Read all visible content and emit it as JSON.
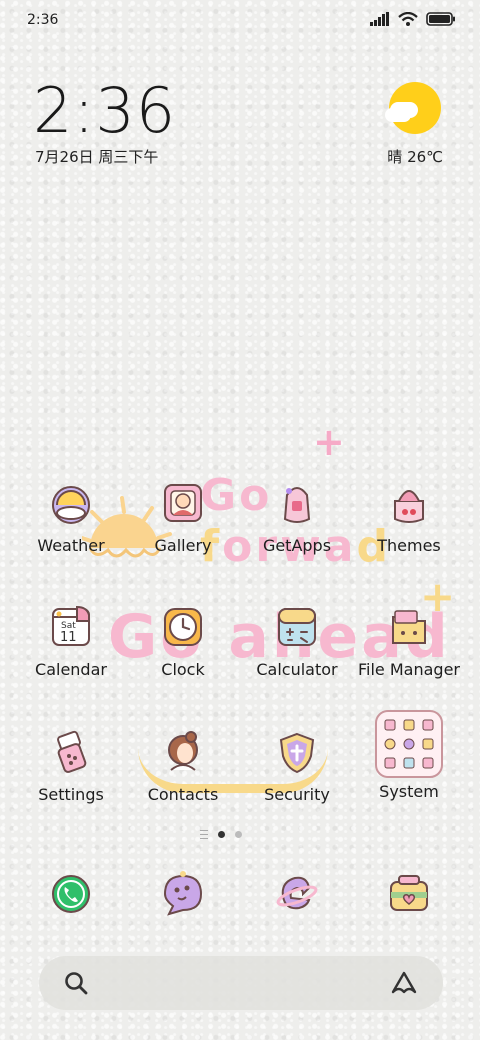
{
  "status_bar": {
    "time": "2:36"
  },
  "clock_widget": {
    "time": "2:36",
    "date": "7月26日 周三下午"
  },
  "weather_widget": {
    "text": "晴 26℃"
  },
  "decorations": {
    "line1_a": "Go ",
    "line1_b": "f",
    "line1_c": "orwa",
    "line1_d": "d",
    "line2": "Go ahead",
    "plus1": "+",
    "plus2": "+"
  },
  "apps": [
    {
      "label": "Weather"
    },
    {
      "label": "Gallery"
    },
    {
      "label": "GetApps"
    },
    {
      "label": "Themes"
    },
    {
      "label": "Calendar"
    },
    {
      "label": "Clock"
    },
    {
      "label": "Calculator"
    },
    {
      "label": "File Manager"
    },
    {
      "label": "Settings"
    },
    {
      "label": "Contacts"
    },
    {
      "label": "Security"
    },
    {
      "label": "System"
    }
  ],
  "calendar_icon": {
    "day": "Sat",
    "date": "11"
  },
  "dock": [
    "phone",
    "messaging",
    "browser",
    "camera"
  ],
  "colors": {
    "accent_pink": "#f7b8cf",
    "accent_yellow": "#f8d98a",
    "sun": "#ffcf1a"
  }
}
